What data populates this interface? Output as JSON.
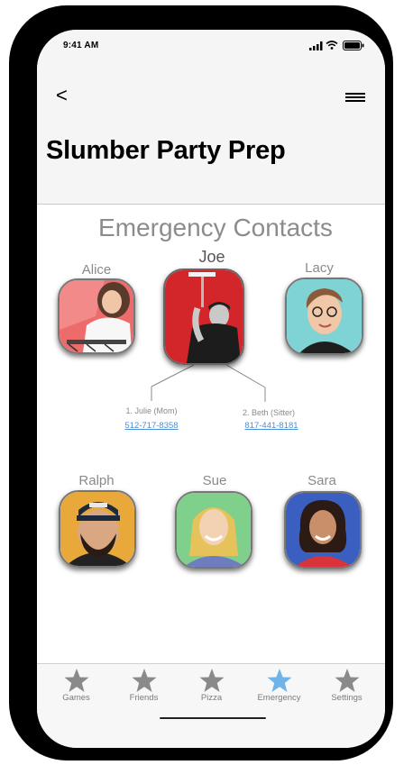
{
  "status_bar": {
    "time": "9:41 AM"
  },
  "header": {
    "back_label": "<",
    "title": "Slumber Party Prep"
  },
  "section": {
    "title": "Emergency Contacts"
  },
  "contacts": [
    {
      "name": "Alice"
    },
    {
      "name": "Joe"
    },
    {
      "name": "Lacy"
    },
    {
      "name": "Ralph"
    },
    {
      "name": "Sue"
    },
    {
      "name": "Sara"
    }
  ],
  "joe_contacts": [
    {
      "label": "1. Julie (Mom)",
      "phone": "512-717-8358"
    },
    {
      "label": "2. Beth (Sitter)",
      "phone": "817-441-8181"
    }
  ],
  "tabs": [
    {
      "label": "Games",
      "icon": "star-icon",
      "active": false
    },
    {
      "label": "Friends",
      "icon": "star-icon",
      "active": false
    },
    {
      "label": "Pizza",
      "icon": "star-icon",
      "active": false
    },
    {
      "label": "Emergency",
      "icon": "star-icon",
      "active": true
    },
    {
      "label": "Settings",
      "icon": "star-icon",
      "active": false
    }
  ],
  "colors": {
    "tab_inactive": "#8a8a8a",
    "tab_active": "#6fb3e8",
    "link": "#4a90d9"
  }
}
